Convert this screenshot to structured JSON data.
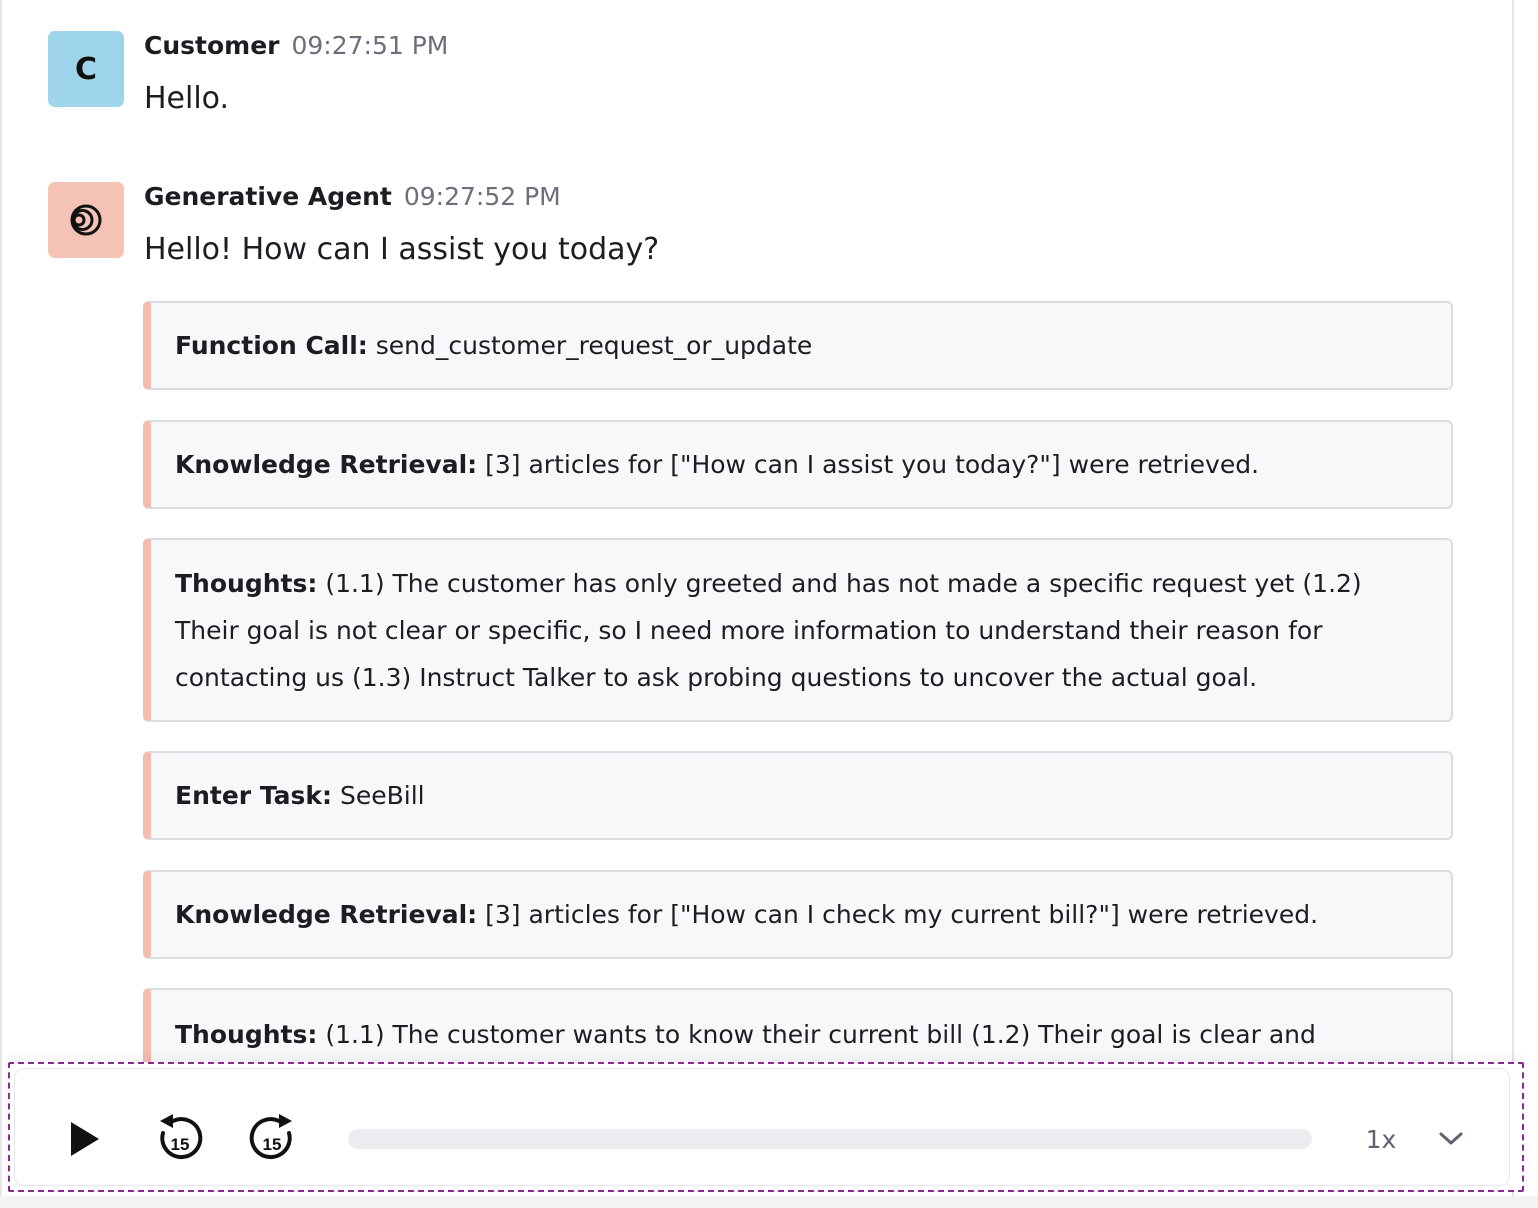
{
  "messages": [
    {
      "avatar_letter": "C",
      "avatar_color": "#9fd5ea",
      "sender": "Customer",
      "time": "09:27:51 PM",
      "text": "Hello."
    },
    {
      "avatar_icon": "generative-agent-logo-icon",
      "avatar_color": "#f4c3b5",
      "sender": "Generative Agent",
      "time": "09:27:52 PM",
      "text": "Hello! How can I assist you today?"
    }
  ],
  "events": [
    {
      "label": "Function Call:",
      "text": "send_customer_request_or_update"
    },
    {
      "label": "Knowledge Retrieval:",
      "text": "[3] articles for [\"How can I assist you today?\"] were retrieved."
    },
    {
      "label": "Thoughts:",
      "text": "(1.1) The customer has only greeted and has not made a specific request yet (1.2) Their goal is not clear or specific, so I need more information to understand their reason for contacting us (1.3) Instruct Talker to ask probing questions to uncover the actual goal."
    },
    {
      "label": "Enter Task:",
      "text": "SeeBill"
    },
    {
      "label": "Knowledge Retrieval:",
      "text": "[3] articles for [\"How can I check my current bill?\"] were retrieved."
    },
    {
      "label": "Thoughts:",
      "text": "(1.1) The customer wants to know their current bill (1.2) Their goal is clear and"
    }
  ],
  "player": {
    "play_icon": "play-icon",
    "rewind_icon": "rewind-15-icon",
    "rewind_seconds": "15",
    "forward_icon": "forward-15-icon",
    "forward_seconds": "15",
    "progress": 0,
    "speed": "1x",
    "speed_menu_icon": "chevron-down-icon"
  },
  "colors": {
    "event_accent": "#f2bcae",
    "highlight_border": "#8a2a8e"
  }
}
